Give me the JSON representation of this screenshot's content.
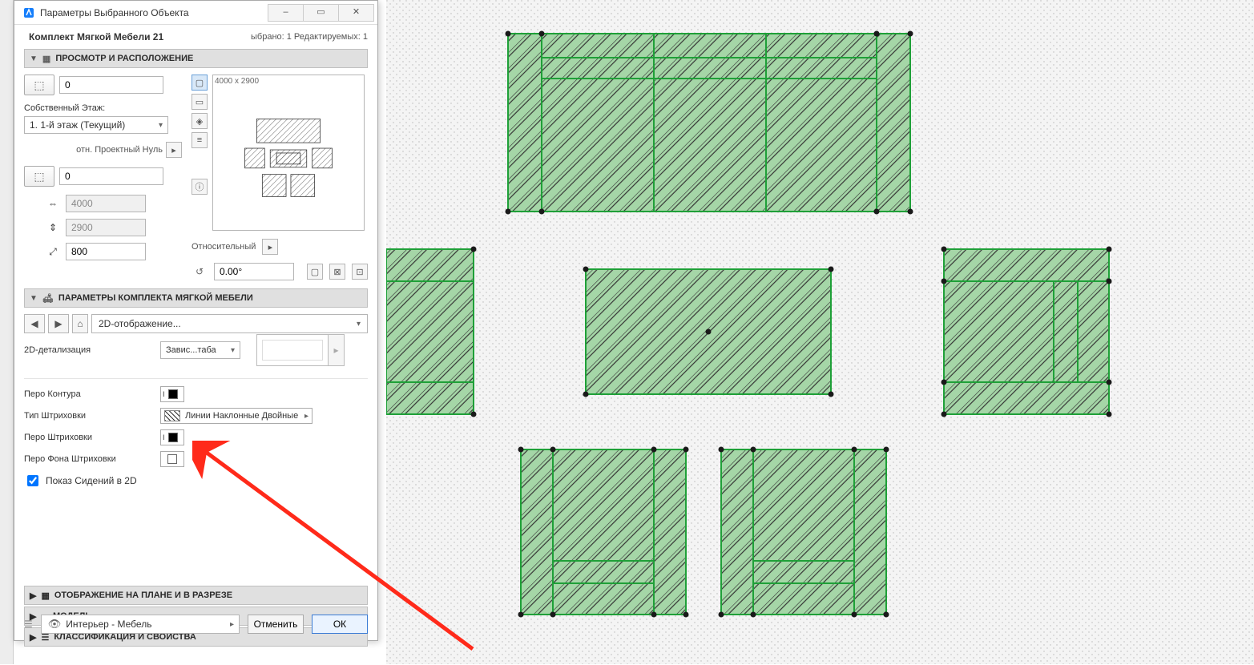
{
  "window": {
    "title": "Параметры Выбранного Объекта",
    "minimize": "–",
    "restore": "▭",
    "close": "✕"
  },
  "header": {
    "object_name": "Комплект Мягкой Мебели 21",
    "sel_info": "ыбрано: 1 Редактируемых: 1"
  },
  "section_preview": {
    "title": "ПРОСМОТР И РАСПОЛОЖЕНИЕ",
    "elev_value": "0",
    "story_label": "Собственный Этаж:",
    "story_value": "1. 1-й этаж (Текущий)",
    "ref_label": "отн. Проектный Нуль",
    "ref_value": "0",
    "dim_x": "4000",
    "dim_y": "2900",
    "dim_z": "800",
    "preview_dims": "4000 x 2900",
    "relative_label": "Относительный",
    "angle": "0.00°"
  },
  "section_params": {
    "title": "ПАРАМЕТРЫ КОМПЛЕКТА МЯГКОЙ МЕБЕЛИ",
    "tab": "2D-отображение...",
    "detail_label": "2D-детализация",
    "detail_value": "Завис...таба",
    "contour_pen": "Перо Контура",
    "hatch_type": "Тип Штриховки",
    "hatch_value": "Линии Наклонные Двойные",
    "hatch_pen": "Перо Штриховки",
    "hatch_bg_pen": "Перо Фона Штриховки",
    "show_seats": "Показ Сидений в 2D"
  },
  "sections_collapsed": {
    "plan": "ОТОБРАЖЕНИЕ НА ПЛАНЕ И В РАЗРЕЗЕ",
    "model": "МОДЕЛЬ",
    "classification": "КЛАССИФИКАЦИЯ И СВОЙСТВА"
  },
  "footer": {
    "layer": "Интерьер - Мебель",
    "cancel": "Отменить",
    "ok": "ОК"
  }
}
